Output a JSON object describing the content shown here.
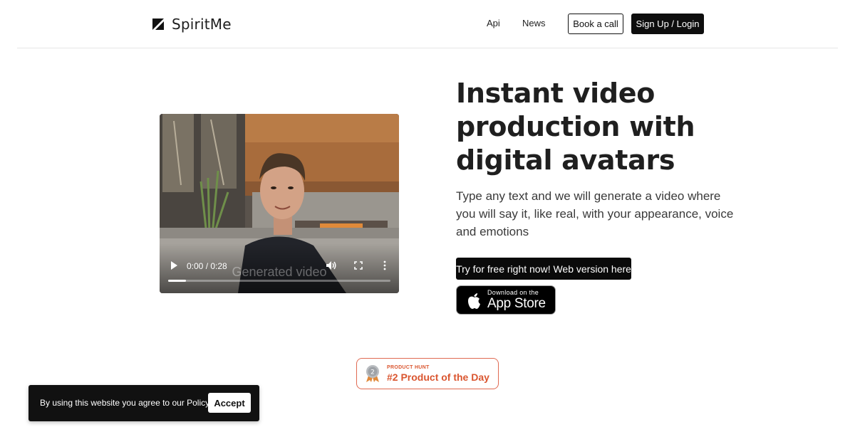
{
  "header": {
    "brand": "SpiritMe",
    "nav": {
      "api": "Api",
      "news": "News"
    },
    "book_call": "Book a call",
    "signup_login": "Sign Up / Login"
  },
  "video": {
    "caption": "Generated video",
    "time": "0:00 / 0:28",
    "progress_fraction": 0.08
  },
  "hero": {
    "title": "Instant video production with digital avatars",
    "subtitle": "Type any text and we will generate a video where you will say it, like real, with your appearance, voice and emotions",
    "cta": "Try for free right now! Web version here",
    "app_store": {
      "small": "Download on the",
      "big": "App Store"
    }
  },
  "product_hunt": {
    "small": "PRODUCT HUNT",
    "big": "#2 Product of the Day",
    "rank": "2",
    "color": "#da5630"
  },
  "cookie": {
    "text": "By using this website you agree to our Policy.",
    "accept": "Accept"
  },
  "icons": {
    "logo": "spiritme-logo-icon",
    "play": "play-icon",
    "volume": "volume-icon",
    "fullscreen": "fullscreen-icon",
    "more": "more-options-icon",
    "apple": "apple-icon",
    "medal": "medal-icon"
  }
}
